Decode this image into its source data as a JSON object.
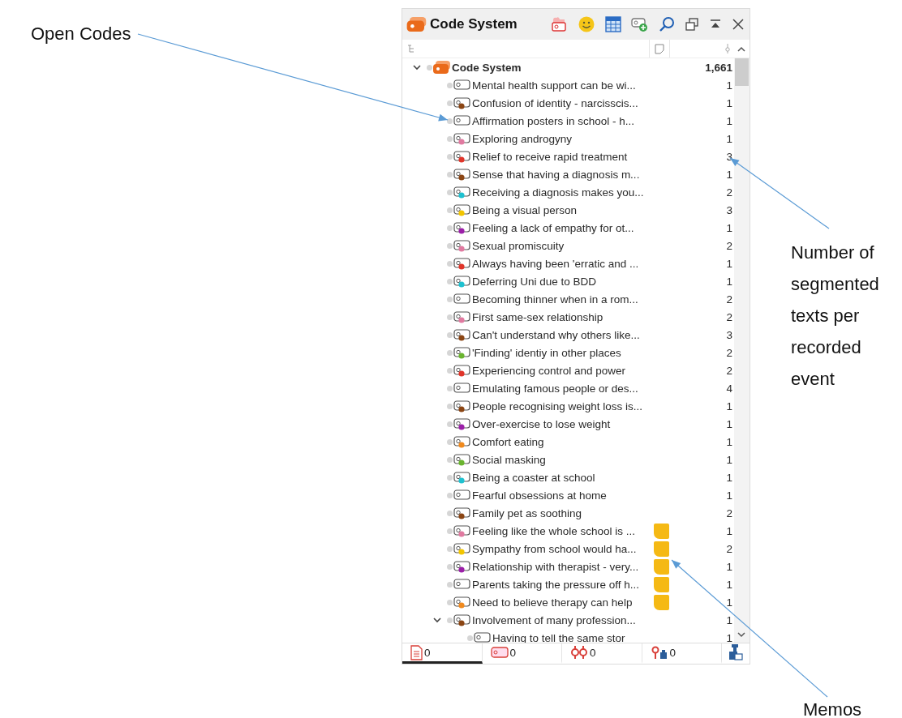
{
  "panel": {
    "title": "Code System",
    "root": {
      "label": "Code System",
      "count": "1,661",
      "expanded": true,
      "children": [
        {
          "label": "Mental health support can be wi...",
          "count": "1",
          "memo": false
        },
        {
          "label": "Confusion of identity - narcisscis...",
          "count": "1",
          "color": "#8b4513",
          "memo": false
        },
        {
          "label": "Affirmation posters in school - h...",
          "count": "1",
          "memo": false
        },
        {
          "label": "Exploring androgyny",
          "count": "1",
          "color": "#e07aa0",
          "memo": false
        },
        {
          "label": "Relief to receive rapid treatment",
          "count": "3",
          "color": "#e0352a",
          "memo": false
        },
        {
          "label": "Sense that having a diagnosis m...",
          "count": "1",
          "color": "#8b4513",
          "memo": false
        },
        {
          "label": "Receiving a diagnosis makes you...",
          "count": "2",
          "color": "#1fc1d0",
          "memo": false
        },
        {
          "label": "Being a visual person",
          "count": "3",
          "color": "#f2c500",
          "memo": false
        },
        {
          "label": "Feeling a lack of empathy for ot...",
          "count": "1",
          "color": "#9b1fa8",
          "memo": false
        },
        {
          "label": "Sexual promiscuity",
          "count": "2",
          "color": "#e07aa0",
          "memo": false
        },
        {
          "label": "Always having been 'erratic and ...",
          "count": "1",
          "color": "#e0352a",
          "memo": false
        },
        {
          "label": "Deferring Uni due to BDD",
          "count": "1",
          "color": "#1fc1d0",
          "memo": false
        },
        {
          "label": "Becoming thinner when in a rom...",
          "count": "2",
          "memo": false
        },
        {
          "label": "First same-sex relationship",
          "count": "2",
          "color": "#e07aa0",
          "memo": false
        },
        {
          "label": "Can't understand why others like...",
          "count": "3",
          "color": "#8b4513",
          "memo": false
        },
        {
          "label": "'Finding' identiy in other places",
          "count": "2",
          "color": "#6ab42f",
          "memo": false
        },
        {
          "label": "Experiencing control and power",
          "count": "2",
          "color": "#e0352a",
          "memo": false
        },
        {
          "label": "Emulating famous people or des...",
          "count": "4",
          "memo": false
        },
        {
          "label": "People recognising weight loss is...",
          "count": "1",
          "color": "#8b4513",
          "memo": false
        },
        {
          "label": "Over-exercise to lose weight",
          "count": "1",
          "color": "#9b1fa8",
          "memo": false
        },
        {
          "label": "Comfort eating",
          "count": "1",
          "color": "#f08a1e",
          "memo": false
        },
        {
          "label": "Social masking",
          "count": "1",
          "color": "#6ab42f",
          "memo": false
        },
        {
          "label": "Being a coaster at school",
          "count": "1",
          "color": "#1fc1d0",
          "memo": false
        },
        {
          "label": "Fearful obsessions at home",
          "count": "1",
          "memo": false
        },
        {
          "label": "Family pet as soothing",
          "count": "2",
          "color": "#8b4513",
          "memo": false
        },
        {
          "label": "Feeling like the whole school is ...",
          "count": "1",
          "color": "#e07aa0",
          "memo": true
        },
        {
          "label": "Sympathy from school would ha...",
          "count": "2",
          "color": "#f2c500",
          "memo": true
        },
        {
          "label": "Relationship with therapist - very...",
          "count": "1",
          "color": "#9b1fa8",
          "memo": true
        },
        {
          "label": "Parents taking the pressure off h...",
          "count": "1",
          "memo": true
        },
        {
          "label": "Need to believe therapy can help",
          "count": "1",
          "color": "#f08a1e",
          "memo": true
        },
        {
          "label": "Involvement of many profession...",
          "count": "1",
          "color": "#8b4513",
          "memo": false,
          "expanded": true,
          "children": [
            {
              "label": "Having to tell the same stor",
              "count": "1",
              "memo": false
            }
          ]
        }
      ]
    }
  },
  "status_bar": [
    {
      "kind": "documents",
      "count": "0",
      "selected": true
    },
    {
      "kind": "codes",
      "count": "0",
      "selected": false
    },
    {
      "kind": "links",
      "count": "0",
      "selected": false
    },
    {
      "kind": "variables",
      "count": "0",
      "selected": false
    },
    {
      "kind": "stamp"
    }
  ],
  "annotations": [
    {
      "kind": "open-codes",
      "text": "Open Codes"
    },
    {
      "kind": "counts",
      "text": "Number of segmented texts per recorded event"
    },
    {
      "kind": "memos",
      "text": "Memos"
    }
  ]
}
